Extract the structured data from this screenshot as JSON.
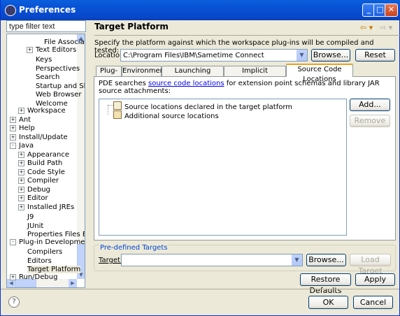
{
  "window": {
    "title": "Preferences"
  },
  "filter": {
    "placeholder": "type filter text",
    "value": "type filter text"
  },
  "tree": {
    "items": [
      {
        "label": "File Associatio",
        "indent": 3,
        "toggle": ""
      },
      {
        "label": "Text Editors",
        "indent": 2,
        "toggle": "+"
      },
      {
        "label": "Keys",
        "indent": 2,
        "toggle": ""
      },
      {
        "label": "Perspectives",
        "indent": 2,
        "toggle": ""
      },
      {
        "label": "Search",
        "indent": 2,
        "toggle": ""
      },
      {
        "label": "Startup and Shutd",
        "indent": 2,
        "toggle": ""
      },
      {
        "label": "Web Browser",
        "indent": 2,
        "toggle": ""
      },
      {
        "label": "Welcome",
        "indent": 2,
        "toggle": ""
      },
      {
        "label": "Workspace",
        "indent": 1,
        "toggle": "+"
      },
      {
        "label": "Ant",
        "indent": 0,
        "toggle": "+"
      },
      {
        "label": "Help",
        "indent": 0,
        "toggle": "+"
      },
      {
        "label": "Install/Update",
        "indent": 0,
        "toggle": "+"
      },
      {
        "label": "Java",
        "indent": 0,
        "toggle": "-"
      },
      {
        "label": "Appearance",
        "indent": 1,
        "toggle": "+"
      },
      {
        "label": "Build Path",
        "indent": 1,
        "toggle": "+"
      },
      {
        "label": "Code Style",
        "indent": 1,
        "toggle": "+"
      },
      {
        "label": "Compiler",
        "indent": 1,
        "toggle": "+"
      },
      {
        "label": "Debug",
        "indent": 1,
        "toggle": "+"
      },
      {
        "label": "Editor",
        "indent": 1,
        "toggle": "+"
      },
      {
        "label": "Installed JREs",
        "indent": 1,
        "toggle": "+"
      },
      {
        "label": "J9",
        "indent": 1,
        "toggle": ""
      },
      {
        "label": "JUnit",
        "indent": 1,
        "toggle": ""
      },
      {
        "label": "Properties Files E",
        "indent": 1,
        "toggle": ""
      },
      {
        "label": "Plug-in Development",
        "indent": 0,
        "toggle": "-"
      },
      {
        "label": "Compilers",
        "indent": 1,
        "toggle": ""
      },
      {
        "label": "Editors",
        "indent": 1,
        "toggle": ""
      },
      {
        "label": "Target Platform",
        "indent": 1,
        "toggle": "",
        "selected": true
      },
      {
        "label": "Run/Debug",
        "indent": 0,
        "toggle": "+"
      }
    ]
  },
  "page": {
    "title": "Target Platform",
    "description": "Specify the platform against which the workspace plug-ins will be compiled and tested:",
    "location_label": "Location:",
    "location_value": "C:\\Program Files\\IBM\\Sametime Connect",
    "browse_label": "Browse...",
    "reset_label": "Reset"
  },
  "tabs": [
    {
      "label": "Plug-ins"
    },
    {
      "label": "Environment"
    },
    {
      "label": "Launching Arguments"
    },
    {
      "label": "Implicit Dependencies"
    },
    {
      "label": "Source Code Locations",
      "active": true
    }
  ],
  "source_tab": {
    "desc_prefix": "PDE searches ",
    "desc_link": "source code locations",
    "desc_suffix": " for extension point schemas and library JAR",
    "desc_line2": "source attachments:",
    "list": [
      {
        "label": "Source locations declared in the target platform",
        "icon": "library-icon"
      },
      {
        "label": "Additional source locations",
        "icon": "edit-folder-icon"
      }
    ],
    "add_label": "Add...",
    "remove_label": "Remove"
  },
  "predefined": {
    "group_label": "Pre-defined Targets",
    "target_label": "Target:",
    "target_value": "",
    "browse_label": "Browse...",
    "load_label": "Load Target"
  },
  "footer": {
    "restore_label": "Restore Defaults",
    "apply_label": "Apply",
    "ok_label": "OK",
    "cancel_label": "Cancel"
  }
}
